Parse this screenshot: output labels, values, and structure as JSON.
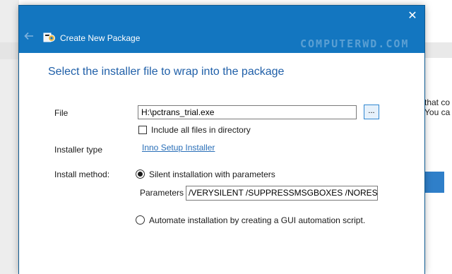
{
  "background": {
    "right_text_1": "that co",
    "right_text_2": "You ca"
  },
  "dialog": {
    "title": "Create New Package",
    "watermark": "COMPUTERWD.COM",
    "close_glyph": "✕",
    "heading": "Select the installer file to wrap into the package",
    "file": {
      "label": "File",
      "value": "H:\\pctrans_trial.exe",
      "browse_label": "..."
    },
    "include_all": {
      "label": "Include all files in directory",
      "checked": false
    },
    "installer_type": {
      "label": "Installer type",
      "value": "Inno Setup Installer"
    },
    "install_method": {
      "label": "Install method:",
      "silent_label": "Silent installation with parameters",
      "parameters_label": "Parameters",
      "parameters_value": "/VERYSILENT /SUPPRESSMSGBOXES /NORESTART",
      "automate_label": "Automate installation by creating a GUI automation script.",
      "selected": "silent"
    }
  },
  "colors": {
    "titlebar": "#1376c0",
    "heading": "#1f5fa8",
    "link": "#2a6fb8"
  },
  "icons": {
    "back": "arrow-left-icon",
    "package": "package-gear-icon",
    "close": "close-icon"
  }
}
